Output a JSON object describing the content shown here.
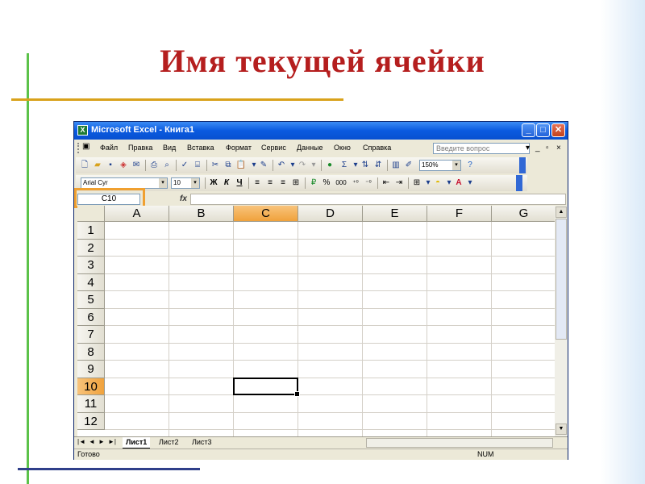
{
  "slide": {
    "title": "Имя текущей ячейки"
  },
  "window": {
    "title": "Microsoft Excel - Книга1",
    "controls": {
      "minimize": "_",
      "maximize": "□",
      "close": "✕"
    }
  },
  "menu": {
    "items": [
      "Файл",
      "Правка",
      "Вид",
      "Вставка",
      "Формат",
      "Сервис",
      "Данные",
      "Окно",
      "Справка"
    ],
    "ask_placeholder": "Введите вопрос"
  },
  "toolbar1": {
    "zoom": "150%"
  },
  "toolbar2": {
    "font": "Arial Cyr",
    "size": "10",
    "bold": "Ж",
    "italic": "К",
    "underline": "Ч",
    "percent": "%",
    "thousands": "000"
  },
  "formula_bar": {
    "name_box": "C10",
    "fx": "fx"
  },
  "grid": {
    "columns": [
      "A",
      "B",
      "C",
      "D",
      "E",
      "F",
      "G"
    ],
    "rows": [
      "1",
      "2",
      "3",
      "4",
      "5",
      "6",
      "7",
      "8",
      "9",
      "10",
      "11",
      "12"
    ],
    "selected_column": "C",
    "selected_row": "10"
  },
  "sheets": {
    "nav": [
      "|◄",
      "◄",
      "►",
      "►|"
    ],
    "tabs": [
      "Лист1",
      "Лист2",
      "Лист3"
    ],
    "active": "Лист1"
  },
  "status": {
    "text": "Готово",
    "num": "NUM"
  },
  "colors": {
    "title_red": "#b51e1e",
    "highlight_orange": "#f0a030",
    "xp_blue": "#0a5ae0"
  }
}
